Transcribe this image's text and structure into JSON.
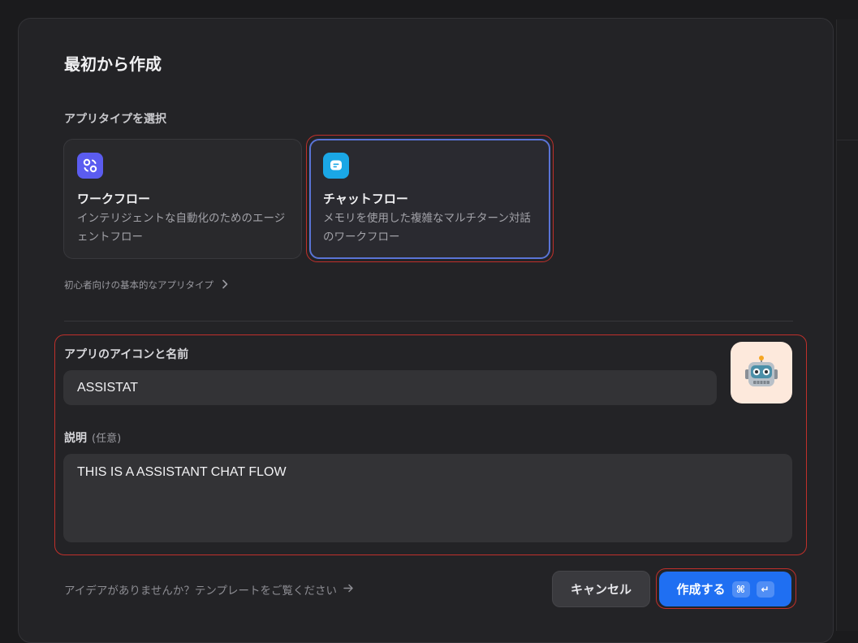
{
  "dialog": {
    "title": "最初から作成",
    "app_type_label": "アプリタイプを選択",
    "cards": [
      {
        "title": "ワークフロー",
        "description": "インテリジェントな自動化のためのエージェントフロー",
        "icon": "workflow-icon",
        "icon_color": "#5b5cf0",
        "selected": false
      },
      {
        "title": "チャットフロー",
        "description": "メモリを使用した複雑なマルチターン対話のワークフロー",
        "icon": "chat-icon",
        "icon_color": "#1aa7e6",
        "selected": true
      }
    ],
    "beginner_link": "初心者向けの基本的なアプリタイプ",
    "name_label": "アプリのアイコンと名前",
    "name_value": "ASSISTAT",
    "app_icon": "robot-emoji",
    "app_icon_bg": "#fde9dc",
    "description_label": "説明",
    "description_optional": "(任意)",
    "description_value": "THIS IS A ASSISTANT CHAT FLOW",
    "template_link": "アイデアがありませんか？テンプレートをご覧ください",
    "cancel_label": "キャンセル",
    "create_label": "作成する",
    "create_shortcut_1": "⌘",
    "create_shortcut_2": "↵",
    "accent_color": "#1f6ff2",
    "highlight_color": "#c0302b"
  }
}
